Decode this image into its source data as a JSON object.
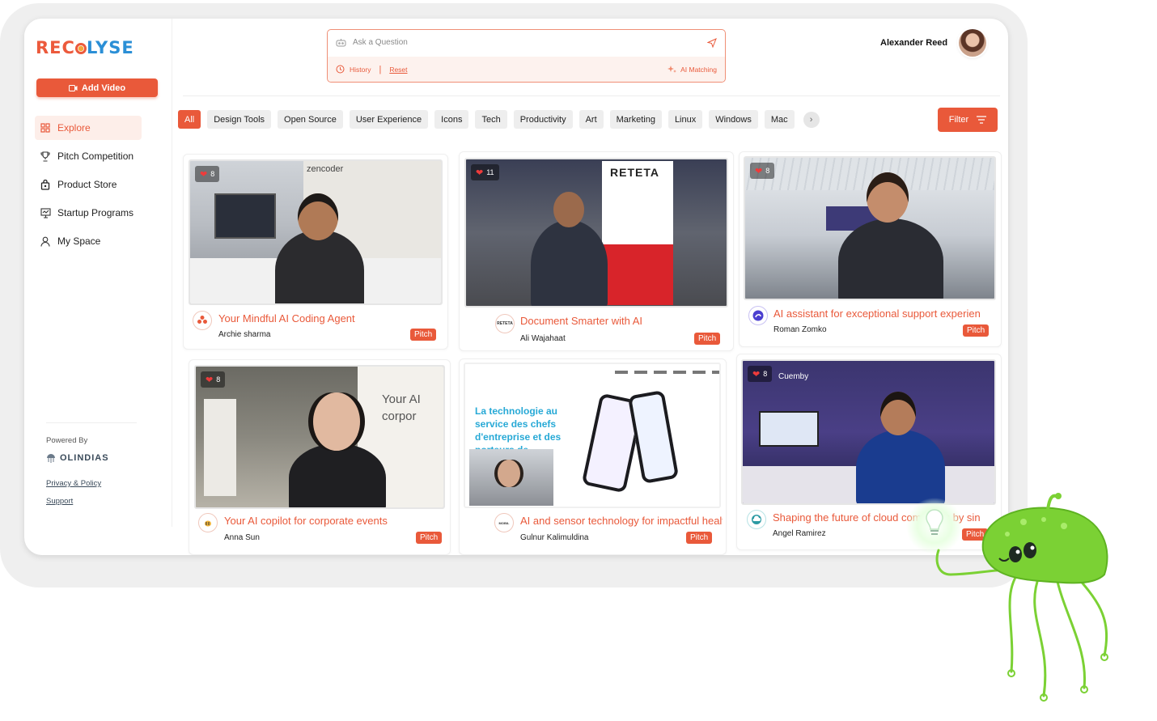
{
  "app": {
    "logo_part1": "REC",
    "logo_part2": "LYSE",
    "add_video_label": "Add Video",
    "user_name": "Alexander Reed"
  },
  "sidebar": {
    "items": [
      {
        "label": "Explore",
        "icon": "grid-icon",
        "active": true
      },
      {
        "label": "Pitch Competition",
        "icon": "trophy-icon",
        "active": false
      },
      {
        "label": "Product Store",
        "icon": "bag-icon",
        "active": false
      },
      {
        "label": "Startup Programs",
        "icon": "presentation-icon",
        "active": false
      },
      {
        "label": "My Space",
        "icon": "user-icon",
        "active": false
      }
    ],
    "powered_by": "Powered By",
    "powered_brand": "OLINDIAS",
    "privacy_label": "Privacy & Policy",
    "support_label": "Support"
  },
  "search": {
    "placeholder": "Ask a Question",
    "history_label": "History",
    "separator": "|",
    "reset_label": "Reset",
    "ai_matching_label": "AI Matching"
  },
  "tags": [
    "All",
    "Design Tools",
    "Open Source",
    "User Experience",
    "Icons",
    "Tech",
    "Productivity",
    "Art",
    "Marketing",
    "Linux",
    "Windows",
    "Mac"
  ],
  "filter_label": "Filter",
  "cards": [
    {
      "title": "Your Mindful AI Coding Agent",
      "author": "Archie sharma",
      "likes": "8",
      "badge": "Pitch",
      "booth_text": "zencoder"
    },
    {
      "title": "Document Smarter with AI",
      "author": "Ali Wajahaat",
      "likes": "11",
      "badge": "Pitch",
      "booth_text": "RETETA",
      "logo_text": "RETETA"
    },
    {
      "title": "AI assistant for exceptional support experien",
      "author": "Roman Zomko",
      "likes": "8",
      "badge": "Pitch"
    },
    {
      "title": "Your AI copilot for corporate events",
      "author": "Anna Sun",
      "likes": "8",
      "badge": "Pitch",
      "booth_text": "Your AI corpor"
    },
    {
      "title": "AI and sensor technology for impactful healt!",
      "author": "Gulnur Kalimuldina",
      "badge": "Pitch",
      "booth_text": "La technologie au service des chefs d'entreprise et des porteurs de",
      "logo_text": "MOBIL"
    },
    {
      "title": "Shaping the future of cloud computing by sin",
      "author": "Angel Ramirez",
      "likes": "8",
      "badge": "Pitch",
      "booth_text": "Cuemby"
    }
  ],
  "colors": {
    "accent": "#e9593a",
    "accent_light": "#fdeee9",
    "blue": "#2b8fd6"
  }
}
